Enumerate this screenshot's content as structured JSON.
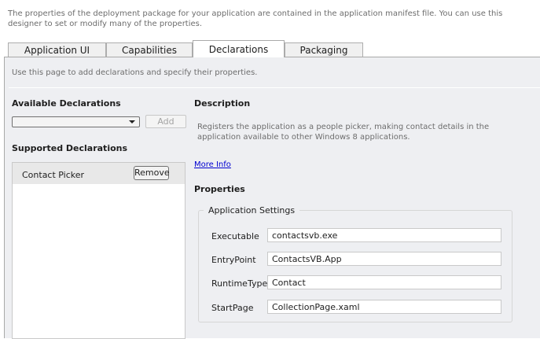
{
  "intro": "The properties of the deployment package for your application are contained in the application manifest file. You can use this designer to set or modify many of the properties.",
  "tabs": [
    {
      "label": "Application UI",
      "active": false
    },
    {
      "label": "Capabilities",
      "active": false
    },
    {
      "label": "Declarations",
      "active": true
    },
    {
      "label": "Packaging",
      "active": false
    }
  ],
  "panel": {
    "hint": "Use this page to add declarations and specify their properties.",
    "available_title": "Available Declarations",
    "dropdown_value": "",
    "add_label": "Add",
    "supported_title": "Supported Declarations",
    "supported_items": [
      {
        "label": "Contact Picker",
        "remove_label": "Remove"
      }
    ],
    "description_title": "Description",
    "description_text": "Registers the application as a people picker, making contact details in the application available to other Windows 8 applications.",
    "more_info": "More Info",
    "properties_title": "Properties",
    "group_title": "Application Settings",
    "fields": [
      {
        "label": "Executable",
        "value": "contactsvb.exe"
      },
      {
        "label": "EntryPoint",
        "value": "ContactsVB.App"
      },
      {
        "label": "RuntimeType",
        "value": "Contact"
      },
      {
        "label": "StartPage",
        "value": "CollectionPage.xaml"
      }
    ]
  },
  "icons": {
    "dropdown_arrow": "chevron-down-icon"
  }
}
